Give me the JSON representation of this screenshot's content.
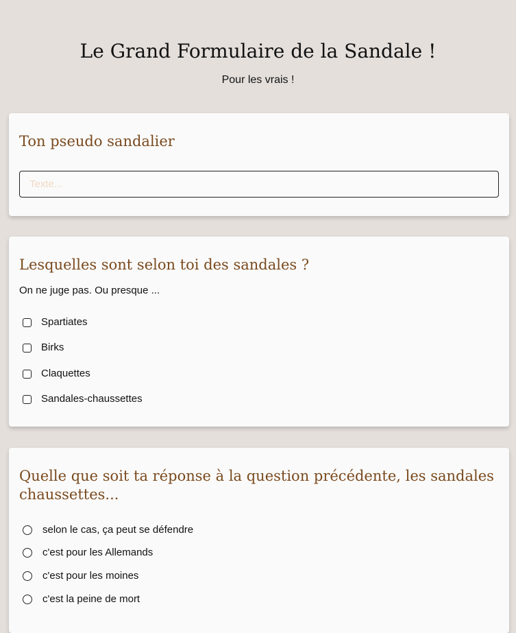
{
  "header": {
    "title": "Le Grand Formulaire de la Sandale !",
    "subtitle": "Pour les vrais !"
  },
  "questions": [
    {
      "title": "Ton pseudo sandalier",
      "input": {
        "value": "",
        "placeholder": "Texte..."
      }
    },
    {
      "title": "Lesquelles sont selon toi des sandales ?",
      "description": "On ne juge pas. Ou presque ...",
      "type": "checkbox",
      "options": [
        "Spartiates",
        "Birks",
        "Claquettes",
        "Sandales-chaussettes"
      ]
    },
    {
      "title": "Quelle que soit ta réponse à la question précédente, les sandales chaussettes...",
      "type": "radio",
      "options": [
        "selon le cas, ça peut se défendre",
        "c'est pour les Allemands",
        "c'est pour les moines",
        "c'est la peine de mort"
      ]
    }
  ],
  "colors": {
    "background": "#e4dfdb",
    "card": "#fafafa",
    "question_title": "#7a4a1e",
    "placeholder": "#f0d9c4"
  }
}
